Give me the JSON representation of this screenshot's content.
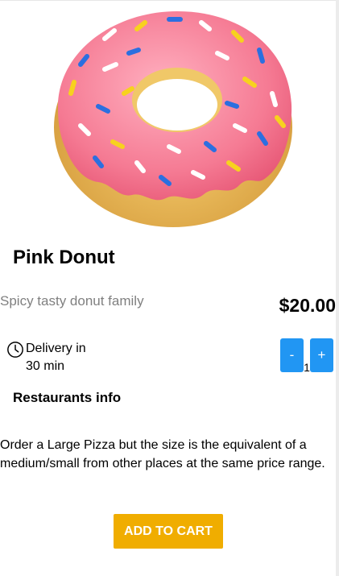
{
  "product": {
    "name": "Pink Donut",
    "tagline": "Spicy tasty donut family",
    "price": "$20.00",
    "image_icon": "pink-donut-image"
  },
  "delivery": {
    "icon": "clock-icon",
    "text": "Delivery in 30 min"
  },
  "quantity": {
    "decrement_label": "-",
    "increment_label": "+",
    "value": "1"
  },
  "restaurant": {
    "heading": "Restaurants info",
    "description": "Order a Large Pizza but the size is the equivalent of a medium/small from other places at the same price range."
  },
  "actions": {
    "add_to_cart_label": "ADD TO CART"
  },
  "colors": {
    "accent_blue": "#2196f3",
    "cta_orange": "#f0ad00",
    "muted_text": "#808080",
    "frosting_pink": "#f3768f",
    "dough": "#e6b35a"
  }
}
